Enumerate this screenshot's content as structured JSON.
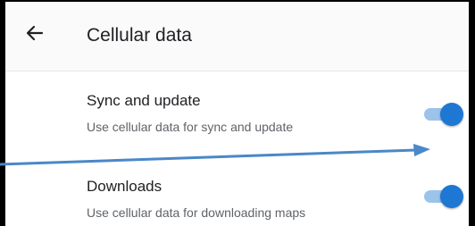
{
  "header": {
    "back_icon": "arrow-left-icon",
    "title": "Cellular data"
  },
  "settings": [
    {
      "title": "Sync and update",
      "subtitle": "Use cellular data for sync and update",
      "enabled": true
    },
    {
      "title": "Downloads",
      "subtitle": "Use cellular data for downloading maps",
      "enabled": true
    }
  ],
  "colors": {
    "toggle_on_thumb": "#1f77d4",
    "toggle_on_track": "#9cc3ea",
    "annotation_arrow": "#4a88c8"
  }
}
